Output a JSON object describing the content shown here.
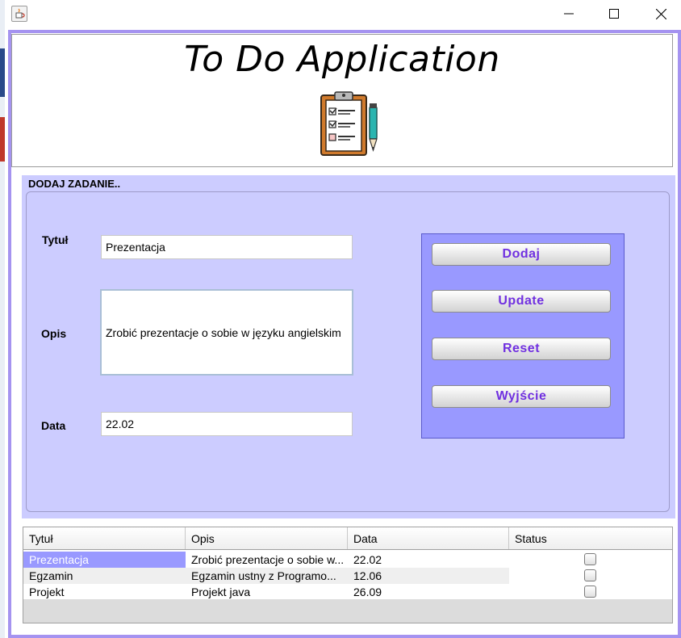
{
  "app": {
    "title": "To Do Application",
    "accent_color": "#a593f0",
    "form_bg_color": "#ccccff",
    "button_panel_color": "#9999ff",
    "button_text_color": "#7030e0"
  },
  "window_controls": {
    "minimize_icon": "minimize-icon",
    "maximize_icon": "maximize-icon",
    "close_icon": "close-icon"
  },
  "form": {
    "section_title": "DODAJ ZADANIE..",
    "title_label": "Tytuł",
    "title_value": "Prezentacja",
    "desc_label": "Opis",
    "desc_value": "Zrobić prezentacje o sobie w języku angielskim",
    "date_label": "Data",
    "date_value": "22.02"
  },
  "buttons": {
    "add": "Dodaj",
    "update": "Update",
    "reset": "Reset",
    "exit": "Wyjście"
  },
  "table": {
    "columns": [
      "Tytuł",
      "Opis",
      "Data",
      "Status"
    ],
    "rows": [
      {
        "title": "Prezentacja",
        "desc": "Zrobić prezentacje o sobie w...",
        "date": "22.02",
        "status": false,
        "selected": true
      },
      {
        "title": "Egzamin",
        "desc": "Egzamin ustny z Programo...",
        "date": "12.06",
        "status": false,
        "selected": false
      },
      {
        "title": "Projekt",
        "desc": "Projekt java",
        "date": "26.09",
        "status": false,
        "selected": false
      }
    ]
  }
}
